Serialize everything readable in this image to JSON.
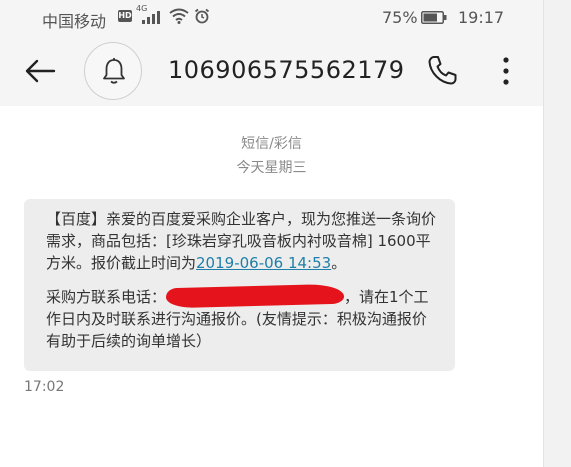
{
  "status_bar": {
    "carrier": "中国移动",
    "hd": "HD",
    "network": "4G",
    "battery": "75%",
    "battery_level": 0.75,
    "time": "19:17"
  },
  "header": {
    "sender": "106906575562179",
    "icons": [
      "back-arrow-icon",
      "bell-icon",
      "phone-icon",
      "more-vertical-icon"
    ]
  },
  "thread": {
    "type_label": "短信/彩信",
    "date_label": "今天星期三"
  },
  "message": {
    "para1_before_date": "【百度】亲爱的百度爱采购企业客户，现为您推送一条询价需求，商品包括：[珍珠岩穿孔吸音板内衬吸音棉] 1600平方米。报价截止时间为",
    "date_link": "2019-06-06 14:53",
    "para1_after_date": "。",
    "para2_before": "采购方联系电话：",
    "para2_after": "，请在1个工作日内及时联系进行沟通报价。(友情提示：积极沟通报价有助于后续的询单增长）",
    "time": "17:02"
  }
}
